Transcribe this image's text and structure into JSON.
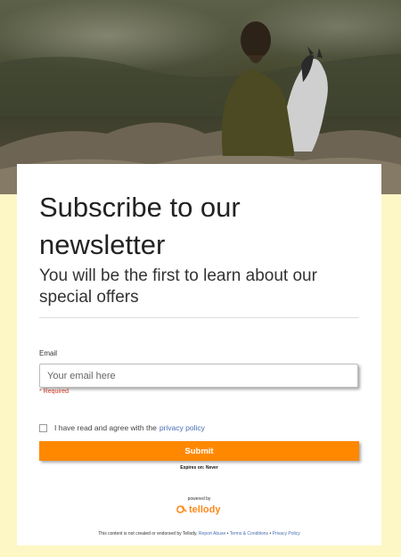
{
  "form": {
    "title": "Subscribe to our newsletter",
    "subtitle": "You will be the first to learn about our special offers",
    "email_label": "Email",
    "email_placeholder": "Your email here",
    "email_value": "",
    "required_text": "* Required",
    "consent_text": "I have read and agree with the",
    "privacy_link_text": "privacy policy",
    "consent_checked": false,
    "submit_label": "Submit",
    "expires_text": "Expires on: Never"
  },
  "branding": {
    "powered_by": "powered by",
    "logo_text": "tellody",
    "logo_color": "#ff8a1c"
  },
  "footer": {
    "disclaimer": "This content is not created or endorsed by Tellody.",
    "report_abuse": "Report Abuse",
    "separator_1": "•",
    "terms": "Terms & Conditions",
    "separator_2": "•",
    "privacy": "Privacy Policy"
  },
  "colors": {
    "background": "#fdf7c5",
    "submit_button": "#ff8800",
    "link": "#4a6fb5",
    "required": "#d03a2c"
  },
  "icons": {
    "logo": "tellody-logo-icon"
  }
}
